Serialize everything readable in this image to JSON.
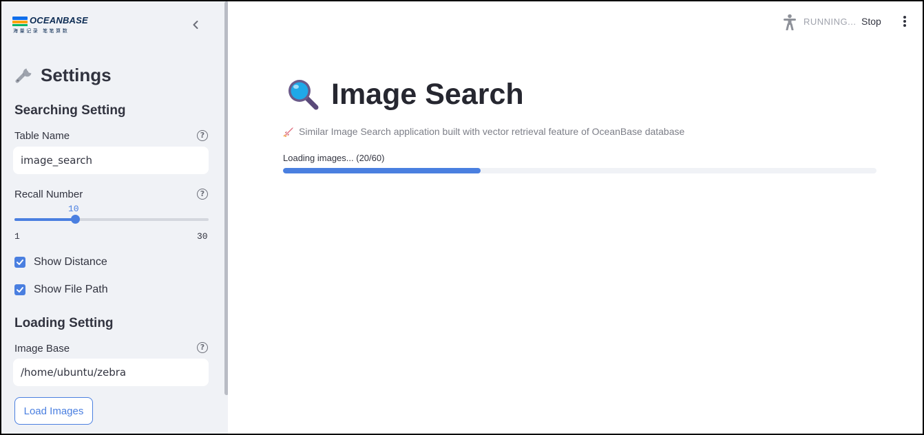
{
  "brand": {
    "name": "OCEANBASE",
    "tagline": "海量记录 笔笔算数"
  },
  "sidebar": {
    "title": "Settings",
    "searching_section": {
      "heading": "Searching Setting",
      "table_name": {
        "label": "Table Name",
        "value": "image_search"
      },
      "recall_number": {
        "label": "Recall Number",
        "value": 10,
        "value_text": "10",
        "min": 1,
        "min_text": "1",
        "max": 30,
        "max_text": "30"
      },
      "show_distance": {
        "label": "Show Distance",
        "checked": true
      },
      "show_file_path": {
        "label": "Show File Path",
        "checked": true
      }
    },
    "loading_section": {
      "heading": "Loading Setting",
      "image_base": {
        "label": "Image Base",
        "value": "/home/ubuntu/zebra"
      },
      "load_button": "Load Images"
    }
  },
  "topbar": {
    "status": "RUNNING...",
    "stop": "Stop"
  },
  "main": {
    "title": "Image Search",
    "subtitle": "Similar Image Search application built with vector retrieval feature of OceanBase database",
    "progress": {
      "label": "Loading images... (20/60)",
      "current": 20,
      "total": 60
    }
  },
  "colors": {
    "accent": "#4a7fe0",
    "sidebar_bg": "#f0f2f6",
    "text": "#31333f"
  },
  "icons": {
    "logo": "oceanbase-logo",
    "collapse": "chevron-left-icon",
    "settings": "wrench-icon",
    "help": "question-circle-icon",
    "running": "running-person-icon",
    "menu": "vertical-dots-icon",
    "title": "magnifying-glass-icon",
    "subtitle": "rocket-icon"
  }
}
